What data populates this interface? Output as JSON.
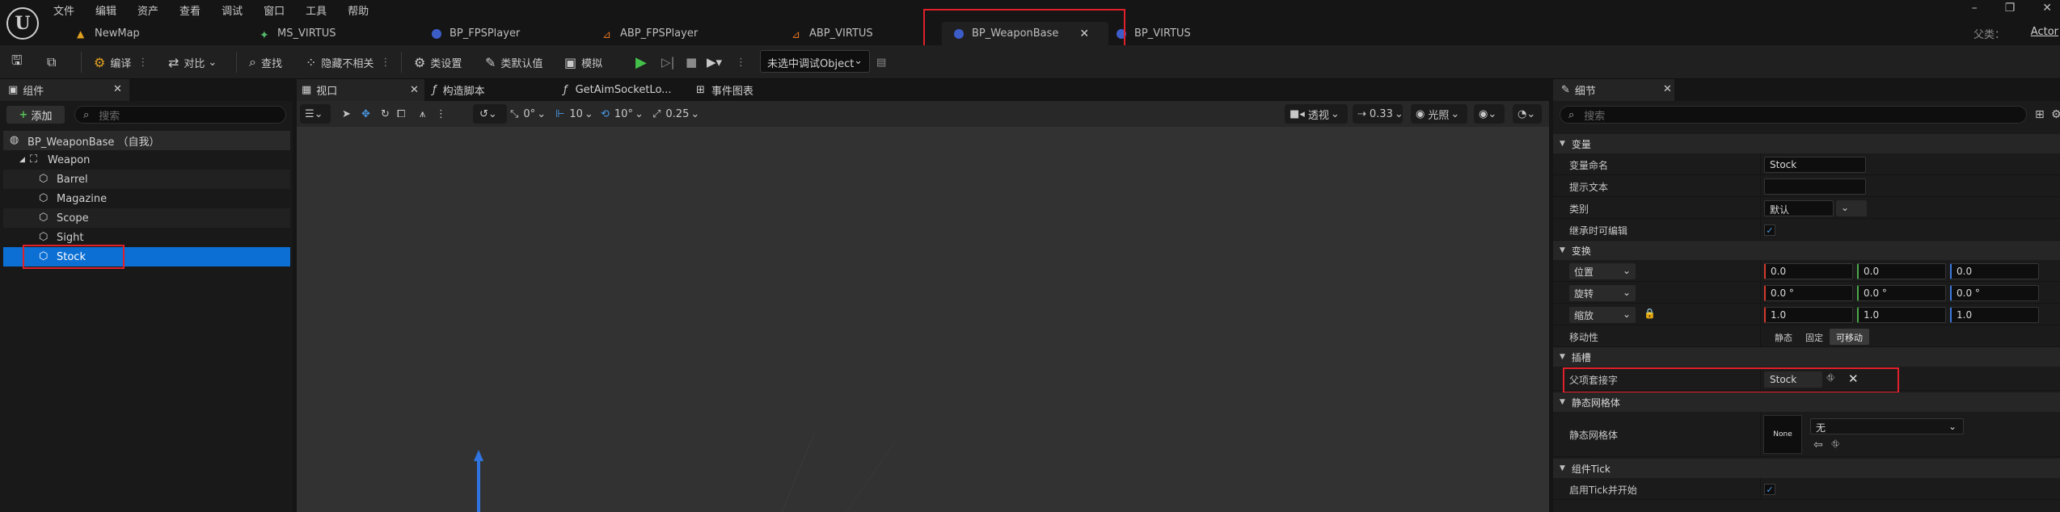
{
  "app": {
    "logo": "U"
  },
  "menu": [
    "文件",
    "编辑",
    "资产",
    "查看",
    "调试",
    "窗口",
    "工具",
    "帮助"
  ],
  "tabs": [
    {
      "label": "NewMap",
      "icon": "map-icon"
    },
    {
      "label": "MS_VIRTUS",
      "icon": "animation-icon"
    },
    {
      "label": "BP_FPSPlayer",
      "icon": "blueprint-icon"
    },
    {
      "label": "ABP_FPSPlayer",
      "icon": "anim-blueprint-icon"
    },
    {
      "label": "ABP_VIRTUS",
      "icon": "anim-blueprint-icon"
    },
    {
      "label": "BP_WeaponBase",
      "icon": "blueprint-icon",
      "active": true
    },
    {
      "label": "BP_VIRTUS",
      "icon": "blueprint-icon"
    }
  ],
  "parent": {
    "label": "父类：",
    "value": "Actor"
  },
  "toolbar": {
    "compile": "编译",
    "diff": "对比",
    "find": "查找",
    "hide_unrelated": "隐藏不相关",
    "class_settings": "类设置",
    "class_defaults": "类默认值",
    "simulate": "模拟",
    "debug_object": "未选中调试Object"
  },
  "components": {
    "title": "组件",
    "add_label": "添加",
    "search_placeholder": "搜索",
    "root": "BP_WeaponBase （自我）",
    "tree": [
      {
        "label": "Weapon",
        "depth": 1,
        "kind": "scene"
      },
      {
        "label": "Barrel",
        "depth": 2,
        "kind": "mesh"
      },
      {
        "label": "Magazine",
        "depth": 2,
        "kind": "mesh"
      },
      {
        "label": "Scope",
        "depth": 2,
        "kind": "mesh"
      },
      {
        "label": "Sight",
        "depth": 2,
        "kind": "mesh"
      },
      {
        "label": "Stock",
        "depth": 2,
        "kind": "mesh",
        "selected": true
      }
    ]
  },
  "center_tabs": [
    {
      "label": "视口",
      "icon": "viewport-icon"
    },
    {
      "label": "构造脚本",
      "icon": "function-icon"
    },
    {
      "label": "GetAimSocketLo...",
      "icon": "function-icon"
    },
    {
      "label": "事件图表",
      "icon": "graph-icon"
    }
  ],
  "viewport": {
    "location_snap": "0°",
    "grid_snap": "10",
    "rotation_snap": "10°",
    "scale_snap": "0.25",
    "perspective": "透视",
    "camera_speed": "0.33",
    "lighting": "光照"
  },
  "details": {
    "title": "细节",
    "search_placeholder": "搜索",
    "sections": {
      "variable": "变量",
      "transform": "变换",
      "sockets": "插槽",
      "static_mesh": "静态网格体",
      "component_tick": "组件Tick"
    },
    "variable_name_label": "变量命名",
    "variable_name_value": "Stock",
    "tooltip_label": "提示文本",
    "tooltip_value": "",
    "category_label": "类别",
    "category_value": "默认",
    "editable_label": "继承时可编辑",
    "editable_checked": true,
    "location_label": "位置",
    "location": [
      "0.0",
      "0.0",
      "0.0"
    ],
    "rotation_label": "旋转",
    "rotation": [
      "0.0 °",
      "0.0 °",
      "0.0 °"
    ],
    "scale_label": "缩放",
    "scale": [
      "1.0",
      "1.0",
      "1.0"
    ],
    "mobility_label": "移动性",
    "mobility_options": [
      "静态",
      "固定",
      "可移动"
    ],
    "mobility_selected": "可移动",
    "parent_socket_label": "父项套接字",
    "parent_socket_value": "Stock",
    "static_mesh_label": "静态网格体",
    "static_mesh_value": "无",
    "thumb_label": "None",
    "start_with_tick_label": "启用Tick并开始",
    "start_with_tick_checked": true
  }
}
